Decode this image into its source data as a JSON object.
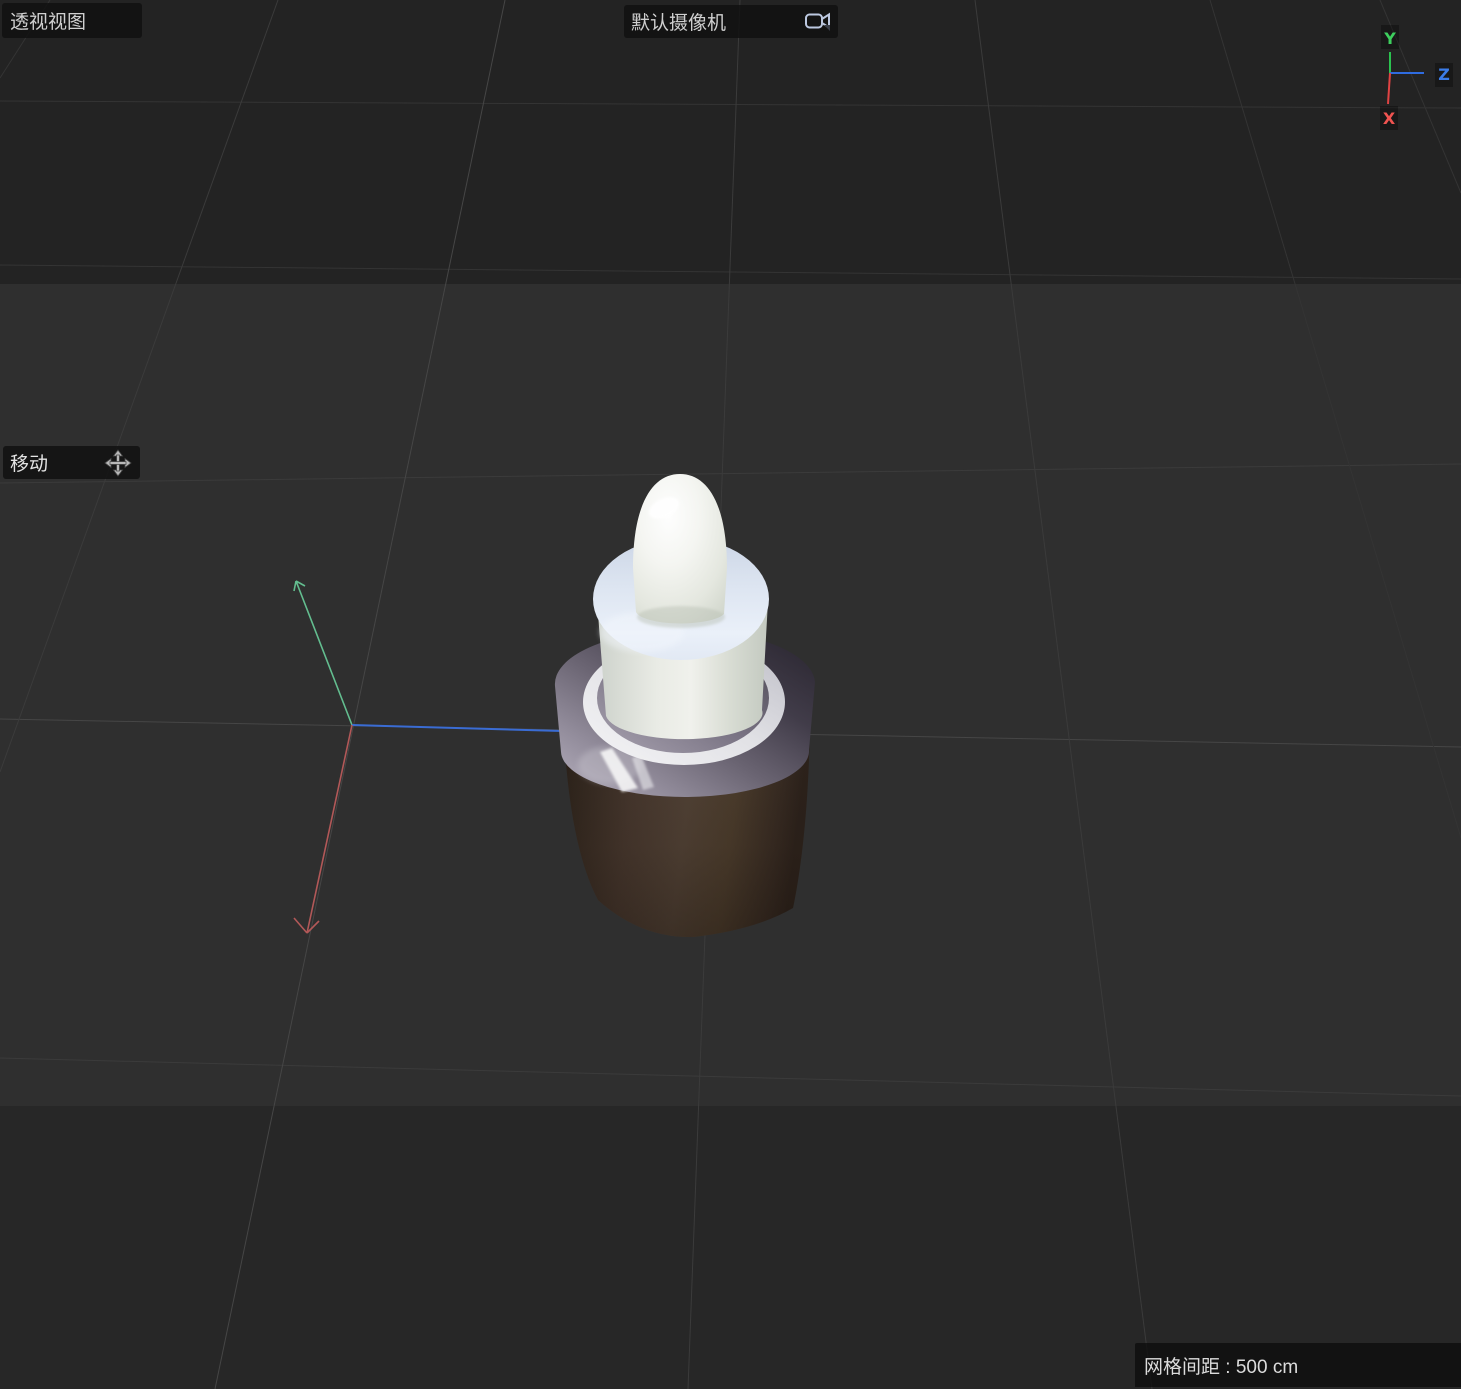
{
  "viewport": {
    "view_label": "透视视图",
    "camera": {
      "label": "默认摄像机",
      "icon": "camera-icon"
    },
    "tool": {
      "label": "移动",
      "icon": "move-icon"
    },
    "status_bar": {
      "grid_spacing": "网格间距 : 500 cm"
    }
  },
  "axis_indicator": {
    "y_label": "Y",
    "z_label": "Z",
    "x_label": "X"
  },
  "colors": {
    "background_top": "#232323",
    "background_mid": "#2f2f2f",
    "background_bottom": "#272727",
    "grid_line": "#3b3b3b",
    "axis_y_green": "#3ecf5e",
    "axis_z_blue": "#3b7ce8",
    "axis_x_red": "#ef5350",
    "gizmo_green": "#63bd8f",
    "gizmo_blue": "#3a6cd4",
    "gizmo_red": "#b25858",
    "bottle_brown": "#4a3a30",
    "cap_white": "#eceee8",
    "dropper_disc_blue_white": "#dde5f1",
    "metal_ring_gray": "#6a6472"
  },
  "scene": {
    "object": "dropper-bottle"
  }
}
